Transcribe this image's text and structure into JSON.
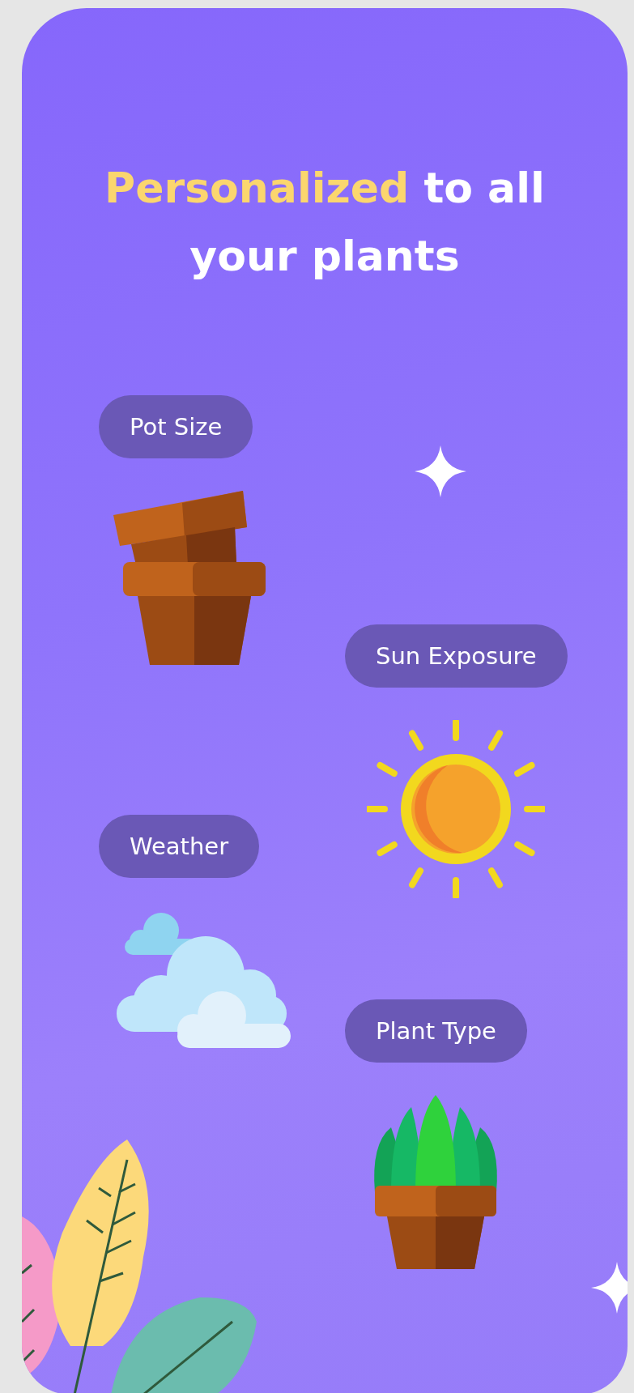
{
  "title": {
    "highlight": "Personalized",
    "rest": "to all your plants"
  },
  "features": [
    {
      "label": "Pot Size",
      "kind": "pots"
    },
    {
      "label": "Sun Exposure",
      "kind": "sun"
    },
    {
      "label": "Weather",
      "kind": "clouds"
    },
    {
      "label": "Plant Type",
      "kind": "plant"
    }
  ]
}
